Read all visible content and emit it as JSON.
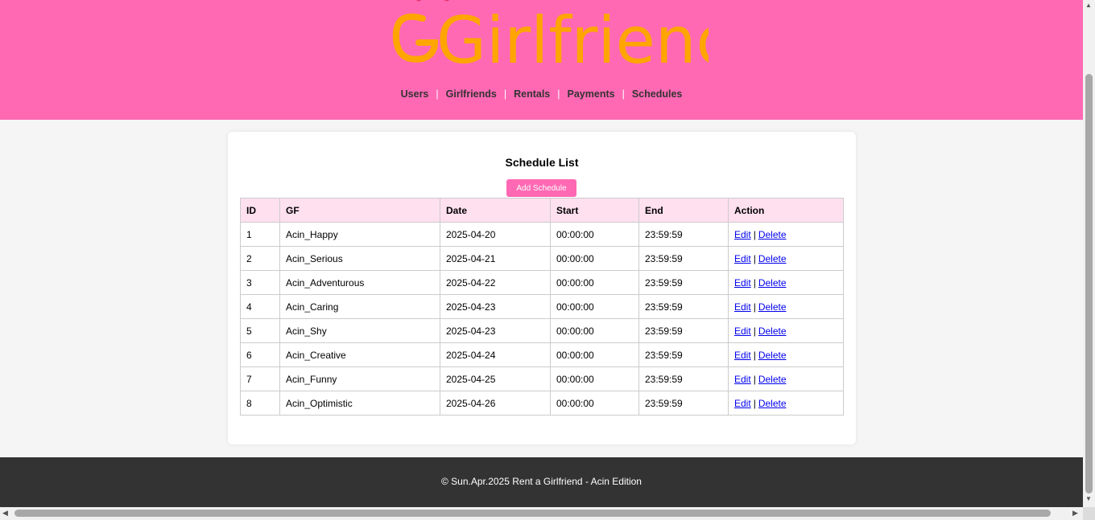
{
  "logo": {
    "text": "Girlfriend",
    "colors": [
      "#ffa500",
      "#e6336e"
    ]
  },
  "nav": {
    "items": [
      {
        "label": "Users"
      },
      {
        "label": "Girlfriends"
      },
      {
        "label": "Rentals"
      },
      {
        "label": "Payments"
      },
      {
        "label": "Schedules"
      }
    ],
    "separator": "|"
  },
  "main": {
    "title": "Schedule List",
    "add_button_label": "Add Schedule",
    "table": {
      "headers": [
        "ID",
        "GF",
        "Date",
        "Start",
        "End",
        "Action"
      ],
      "rows": [
        {
          "id": "1",
          "gf": "Acin_Happy",
          "date": "2025-04-20",
          "start": "00:00:00",
          "end": "23:59:59"
        },
        {
          "id": "2",
          "gf": "Acin_Serious",
          "date": "2025-04-21",
          "start": "00:00:00",
          "end": "23:59:59"
        },
        {
          "id": "3",
          "gf": "Acin_Adventurous",
          "date": "2025-04-22",
          "start": "00:00:00",
          "end": "23:59:59"
        },
        {
          "id": "4",
          "gf": "Acin_Caring",
          "date": "2025-04-23",
          "start": "00:00:00",
          "end": "23:59:59"
        },
        {
          "id": "5",
          "gf": "Acin_Shy",
          "date": "2025-04-23",
          "start": "00:00:00",
          "end": "23:59:59"
        },
        {
          "id": "6",
          "gf": "Acin_Creative",
          "date": "2025-04-24",
          "start": "00:00:00",
          "end": "23:59:59"
        },
        {
          "id": "7",
          "gf": "Acin_Funny",
          "date": "2025-04-25",
          "start": "00:00:00",
          "end": "23:59:59"
        },
        {
          "id": "8",
          "gf": "Acin_Optimistic",
          "date": "2025-04-26",
          "start": "00:00:00",
          "end": "23:59:59"
        }
      ],
      "edit_label": "Edit",
      "delete_label": "Delete",
      "action_separator": "|"
    }
  },
  "footer": {
    "text": "© Sun.Apr.2025 Rent a Girlfriend - Acin Edition"
  },
  "colors": {
    "header_bg": "#ff69b4",
    "button_bg": "#ff69b4",
    "table_header_bg": "#ffe0ef",
    "footer_bg": "#333333"
  }
}
